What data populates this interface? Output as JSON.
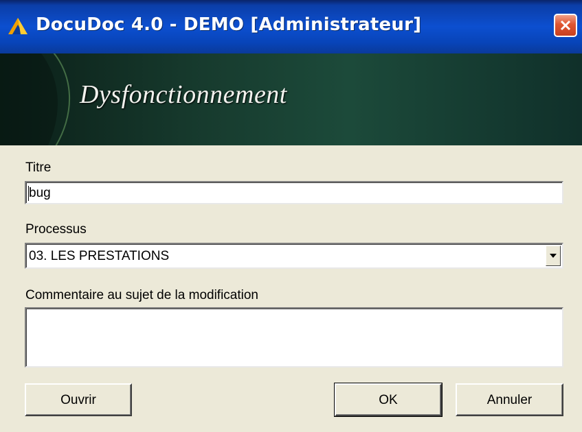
{
  "window": {
    "title": "DocuDoc 4.0 - DEMO [Administrateur]",
    "app_icon": "docudoc-logo-icon",
    "close_icon": "close-icon"
  },
  "banner": {
    "title": "Dysfonctionnement"
  },
  "form": {
    "titre_label": "Titre",
    "titre_value": "bug",
    "processus_label": "Processus",
    "processus_value": "03. LES PRESTATIONS",
    "commentaire_label": "Commentaire au sujet de la modification",
    "commentaire_value": ""
  },
  "buttons": {
    "ouvrir_label": "Ouvrir",
    "ok_label": "OK",
    "annuler_label": "Annuler"
  }
}
